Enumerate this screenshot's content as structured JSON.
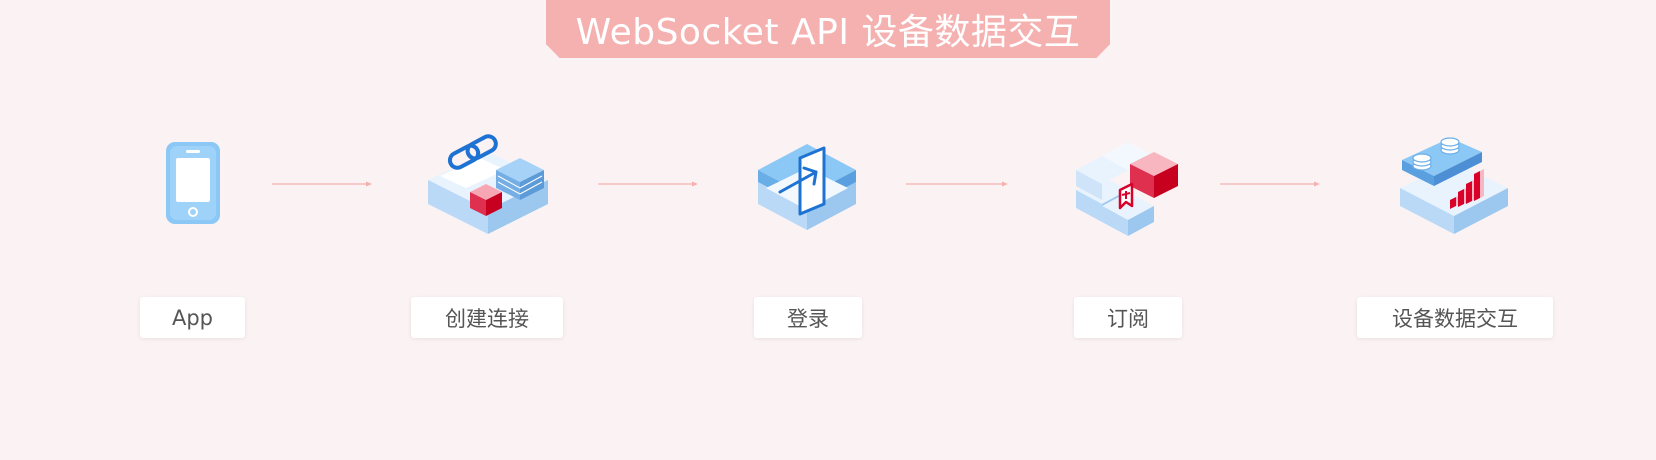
{
  "title": "WebSocket API 设备数据交互",
  "steps": [
    {
      "label": "App",
      "icon": "phone-icon"
    },
    {
      "label": "创建连接",
      "icon": "link-blocks-icon"
    },
    {
      "label": "登录",
      "icon": "login-arrow-icon"
    },
    {
      "label": "订阅",
      "icon": "bookmark-blocks-icon"
    },
    {
      "label": "设备数据交互",
      "icon": "data-chart-icon"
    }
  ],
  "colors": {
    "background": "#fbf3f3",
    "banner": "#f5b0b0",
    "connector": "#f5b0b0",
    "blue": "#8cc8f5",
    "blue_dark": "#1e72d2",
    "red": "#d9002a",
    "pink": "#f7b6c0"
  }
}
